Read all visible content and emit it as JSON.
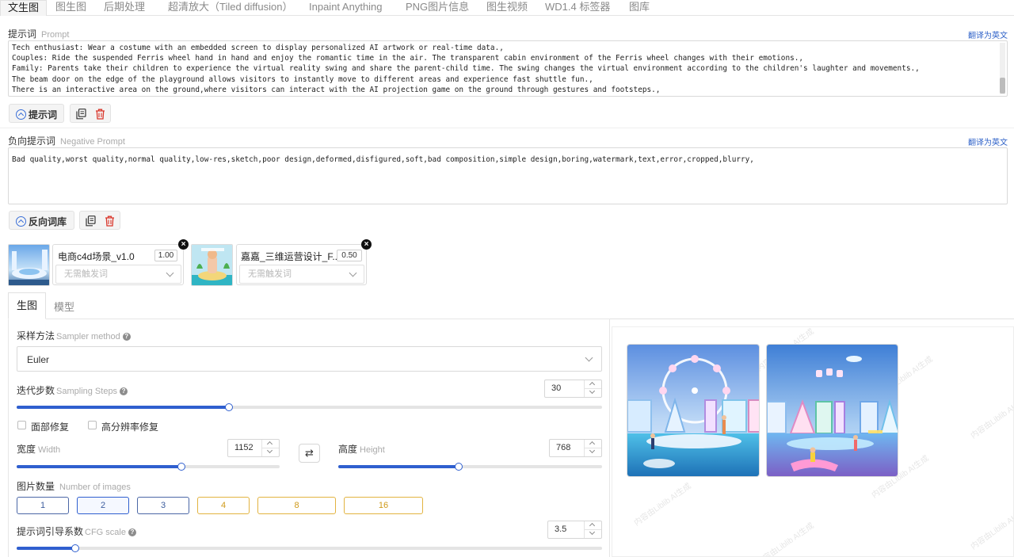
{
  "tabs": [
    "文生图",
    "图生图",
    "后期处理",
    "超清放大（Tiled diffusion）",
    "Inpaint Anything",
    "PNG图片信息",
    "图生视频",
    "WD1.4 标签器",
    "图库"
  ],
  "prompt": {
    "label_cn": "提示词",
    "label_en": "Prompt",
    "translate": "翻译为英文",
    "lines": [
      "Tech enthusiast: Wear a costume with an embedded screen to display personalized AI artwork or real-time data.,",
      "Couples: Ride the suspended Ferris wheel hand in hand and enjoy the romantic time in the air. The transparent cabin environment of the Ferris wheel changes with their emotions.,",
      "Family: Parents take their children to experience the virtual reality swing and share the parent-child time. The swing changes the virtual environment according to the children's laughter and movements.,",
      "The beam door on the edge of the playground allows visitors to instantly move to different areas and experience fast shuttle fun.,",
      "There is an interactive area on the ground,where visitors can interact with the AI projection game on the ground through gestures and footsteps.,"
    ],
    "library_button": "提示词"
  },
  "negative": {
    "label_cn": "负向提示词",
    "label_en": "Negative Prompt",
    "translate": "翻译为英文",
    "text": "Bad quality,worst quality,normal quality,low-res,sketch,poor design,deformed,disfigured,soft,bad composition,simple design,boring,watermark,text,error,cropped,blurry,",
    "library_button": "反向词库"
  },
  "loras": [
    {
      "name": "电商c4d场景_v1.0",
      "weight": "1.00",
      "trigger_placeholder": "无需触发词"
    },
    {
      "name": "嘉嘉_三维运营设计_F...",
      "weight": "0.50",
      "trigger_placeholder": "无需触发词"
    }
  ],
  "settings_tabs": [
    "生图",
    "模型"
  ],
  "sampler": {
    "label_cn": "采样方法",
    "label_en": "Sampler method",
    "value": "Euler"
  },
  "steps": {
    "label_cn": "迭代步数",
    "label_en": "Sampling Steps",
    "value": "30",
    "fraction": 0.362
  },
  "checkboxes": [
    "面部修复",
    "高分辨率修复"
  ],
  "width": {
    "label_cn": "宽度",
    "label_en": "Width",
    "value": "1152",
    "fraction": 0.625
  },
  "height": {
    "label_cn": "高度",
    "label_en": "Height",
    "value": "768",
    "fraction": 0.455
  },
  "swap_icon": "⇄",
  "num_images": {
    "label_cn": "图片数量",
    "label_en": "Number of images",
    "options": [
      "1",
      "2",
      "3",
      "4",
      "8",
      "16"
    ],
    "selected": "2"
  },
  "cfg": {
    "label_cn": "提示词引导系数",
    "label_en": "CFG scale",
    "value": "3.5",
    "fraction": 0.1
  },
  "watermark_text": "内容由Liblib AI生成",
  "colors": {
    "accent": "#2f5fcf",
    "gold": "#e2b340",
    "link": "#2f62c8",
    "delete": "#d9362b"
  }
}
